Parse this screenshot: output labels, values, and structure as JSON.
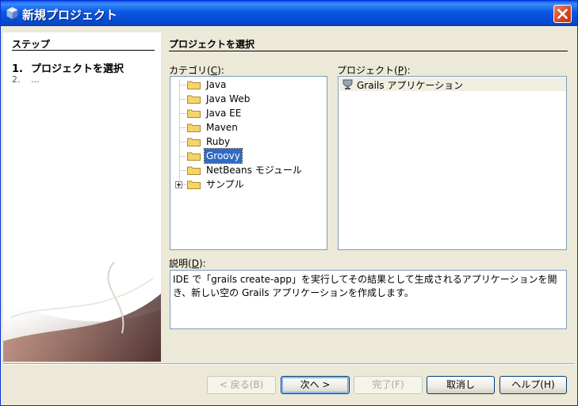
{
  "window": {
    "title": "新規プロジェクト"
  },
  "steps": {
    "heading": "ステップ",
    "items": [
      {
        "num": "1.",
        "label": "プロジェクトを選択"
      },
      {
        "num": "2.",
        "label": "..."
      }
    ]
  },
  "main": {
    "heading": "プロジェクトを選択",
    "categories": {
      "label": "カテゴリ(",
      "mnemonic": "C",
      "label_end": "):",
      "items": [
        "Java",
        "Java Web",
        "Java EE",
        "Maven",
        "Ruby",
        "Groovy",
        "NetBeans モジュール",
        "サンプル"
      ],
      "selected": "Groovy"
    },
    "projects": {
      "label": "プロジェクト(",
      "mnemonic": "P",
      "label_end": "):",
      "items": [
        "Grails アプリケーション"
      ]
    },
    "description": {
      "label": "説明(",
      "mnemonic": "D",
      "label_end": "):",
      "text": "IDE で「grails create-app」を実行してその結果として生成されるアプリケーションを開き、新しい空の Grails アプリケーションを作成します。"
    }
  },
  "buttons": {
    "back": "< 戻る(B)",
    "next": "次へ >",
    "finish": "完了(F)",
    "cancel": "取消し",
    "help": "ヘルプ(H)"
  },
  "colors": {
    "title_bar": "#0a58e4",
    "selection": "#316ac5",
    "folder": "#f4d56a"
  }
}
